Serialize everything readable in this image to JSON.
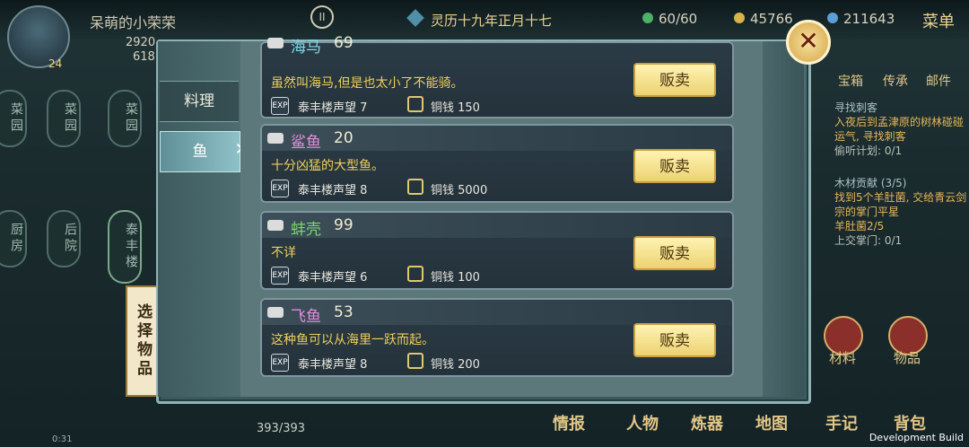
{
  "player": {
    "name": "呆萌的小荣荣",
    "level": "24",
    "stat1": "2920",
    "stat2": "618"
  },
  "calendar": {
    "date": "灵历十九年正月十七"
  },
  "resources": {
    "energy": "60/60",
    "copper": "45766",
    "spirit": "211643"
  },
  "menu": {
    "label": "菜单"
  },
  "map_nodes": [
    "菜园",
    "菜园",
    "菜园",
    "厨房",
    "后院",
    "泰丰楼"
  ],
  "choose_item": "选择物品",
  "tabs": [
    {
      "label": "料理"
    },
    {
      "label": "鱼"
    }
  ],
  "items": [
    {
      "name": "海马",
      "name_color": "#7fd8ea",
      "count": "69",
      "desc": "虽然叫海马,但是也太小了不能骑。",
      "rep": "泰丰楼声望 7",
      "price": "铜钱 150",
      "sell": "贩卖"
    },
    {
      "name": "鲨鱼",
      "name_color": "#e58bd9",
      "count": "20",
      "desc": "十分凶猛的大型鱼。",
      "rep": "泰丰楼声望 8",
      "price": "铜钱 5000",
      "sell": "贩卖"
    },
    {
      "name": "蚌壳",
      "name_color": "#7cd56d",
      "count": "99",
      "desc": "不详",
      "rep": "泰丰楼声望 6",
      "price": "铜钱 100",
      "sell": "贩卖"
    },
    {
      "name": "飞鱼",
      "name_color": "#e58bd9",
      "count": "53",
      "desc": "这种鱼可以从海里一跃而起。",
      "rep": "泰丰楼声望 8",
      "price": "铜钱 200",
      "sell": "贩卖"
    }
  ],
  "quests": [
    {
      "title": "寻找刺客",
      "body": "入夜后到孟津原的树林碰碰运气, 寻找刺客",
      "sub": "偷听计划: 0/1"
    },
    {
      "title": "木材贡献 (3/5)",
      "body": "找到5个羊肚菌, 交给青云剑宗的掌门平星",
      "sub": "羊肚菌2/5",
      "sub2": "上交掌门: 0/1"
    }
  ],
  "right_icons": [
    "材料",
    "物品"
  ],
  "top_right_labels": [
    "宝箱",
    "传承",
    "邮件"
  ],
  "bottom_nav": [
    "情报",
    "人物",
    "炼器",
    "地图",
    "手记",
    "背包"
  ],
  "status": {
    "time": "0:31",
    "hp": "393/393"
  },
  "dev_label": "Development Build"
}
